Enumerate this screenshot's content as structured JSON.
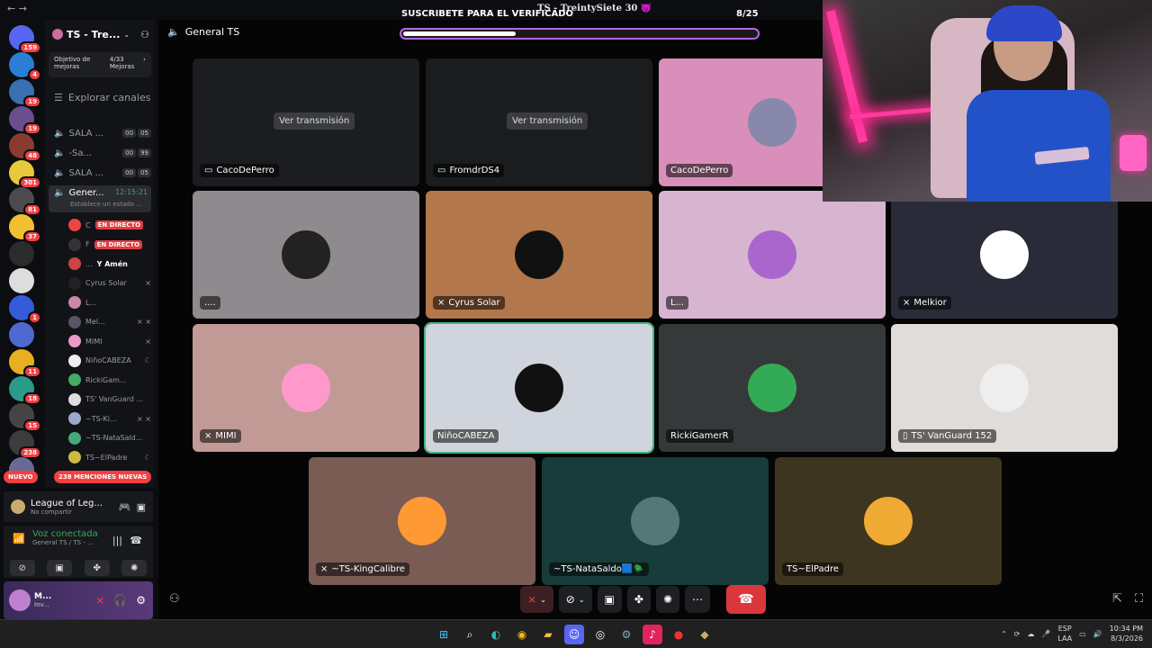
{
  "window": {
    "title": "TS - TreintySiete 30 😈"
  },
  "guilds": [
    {
      "badge": "159",
      "color": "#5865f2"
    },
    {
      "badge": "4",
      "color": "#2a7fd4"
    },
    {
      "badge": "19",
      "color": "#3a6fb0"
    },
    {
      "badge": "19",
      "color": "#6a4f8f"
    },
    {
      "badge": "48",
      "color": "#8a3b2f"
    },
    {
      "badge": "301",
      "color": "#e8c93a"
    },
    {
      "badge": "81",
      "color": "#4b4b4b"
    },
    {
      "badge": "37",
      "color": "#f0c030"
    },
    {
      "badge": "",
      "color": "#2c2c2c"
    },
    {
      "badge": "",
      "color": "#ddd"
    },
    {
      "badge": "1",
      "color": "#355bd8"
    },
    {
      "badge": "",
      "color": "#4e6ad0"
    },
    {
      "badge": "11",
      "color": "#e8b020"
    },
    {
      "badge": "18",
      "color": "#2a9a8a"
    },
    {
      "badge": "15",
      "color": "#444"
    },
    {
      "badge": "238",
      "color": "#3c3c3c"
    },
    {
      "badge": "",
      "color": "#6a6a9a"
    }
  ],
  "server": {
    "name": "TS - Tre...",
    "boost_label": "Objetivo de mejoras",
    "boost_value": "4/33",
    "boost_unit": "Mejoras",
    "explore": "Explorar canales"
  },
  "channels": [
    {
      "name": "SALA ...",
      "c1": "00",
      "c2": "05"
    },
    {
      "name": "-Sa...",
      "c1": "00",
      "c2": "99"
    },
    {
      "name": "SALA ...",
      "c1": "00",
      "c2": "05"
    }
  ],
  "active_channel": {
    "name": "Gener...",
    "time": "12:15:21",
    "status": "Establece un estado ..."
  },
  "members": [
    {
      "name": "C",
      "live": "EN DIRECTO",
      "color": "#e44"
    },
    {
      "name": "F",
      "live": "EN DIRECTO",
      "color": "#333"
    },
    {
      "name": "...",
      "tag": "Y Amén",
      "color": "#c44"
    },
    {
      "name": "Cyrus Solar",
      "icon": "⨯",
      "color": "#222"
    },
    {
      "name": "L...",
      "icon": "",
      "color": "#c8a"
    },
    {
      "name": "Mel...",
      "icon": "⨯ ⨯",
      "color": "#556"
    },
    {
      "name": "MIMI",
      "icon": "⨯",
      "color": "#e9c"
    },
    {
      "name": "NiñoCABEZA",
      "icon": "☾",
      "color": "#eee"
    },
    {
      "name": "RickiGam...",
      "icon": "",
      "color": "#4a6"
    },
    {
      "name": "TS' VanGuard ...",
      "icon": "",
      "color": "#ddd"
    },
    {
      "name": "~TS-Ki...",
      "icon": "⨯ ⨯",
      "color": "#9ac"
    },
    {
      "name": "~TS-NataSald...",
      "icon": "",
      "color": "#4a7"
    },
    {
      "name": "TS~ElPadre",
      "icon": "☾",
      "color": "#cb4"
    }
  ],
  "pills": {
    "new": "NUEVO",
    "mentions": "238 MENCIONES NUEVAS"
  },
  "activity": {
    "title": "League of Leg...",
    "sub": "No compartir"
  },
  "voice": {
    "title": "Voz conectada",
    "sub": "General TS / TS - ..."
  },
  "user": {
    "name": "M...",
    "status": "Inv..."
  },
  "stage": {
    "channel": "General TS",
    "banner": "SUSCRIBETE PARA EL VERIFICADO",
    "counter": "8/25",
    "progress": 0.32
  },
  "tiles": [
    {
      "label": "CacoDePerro",
      "bg": "#1c1d20",
      "watch": "Ver transmisión",
      "icon": "▭"
    },
    {
      "label": "FromdrDS4",
      "bg": "#1a1c1d",
      "watch": "Ver transmisión",
      "icon": "▭"
    },
    {
      "label": "CacoDePerro",
      "bg": "#d98fba",
      "watch": "",
      "icon": ""
    },
    {
      "label": "....",
      "bg": "#8f8a8e",
      "watch": "",
      "icon": ""
    },
    {
      "label": "Cyrus Solar",
      "bg": "#b2774b",
      "watch": "",
      "icon": "⨯"
    },
    {
      "label": "L...",
      "bg": "#d7b4cf",
      "watch": "",
      "icon": ""
    },
    {
      "label": "Melkior",
      "bg": "#2a2b38",
      "watch": "",
      "icon": "⨯"
    },
    {
      "label": "MIMI",
      "bg": "#c19a95",
      "watch": "",
      "icon": "⨯"
    },
    {
      "label": "NiñoCABEZA",
      "bg": "#d0d4dc",
      "watch": "",
      "icon": ""
    },
    {
      "label": "RickiGamerR",
      "bg": "#36393a",
      "watch": "",
      "icon": ""
    },
    {
      "label": "TS' VanGuard 152",
      "bg": "#e0dcd9",
      "watch": "",
      "icon": "▯"
    },
    {
      "label": "~TS-KingCalibre",
      "bg": "#7a5c55",
      "watch": "",
      "icon": "⨯"
    },
    {
      "label": "~TS-NataSaldo🟦🪲",
      "bg": "#173c3a",
      "watch": "",
      "icon": ""
    },
    {
      "label": "TS~ElPadre",
      "bg": "#3e3520",
      "watch": "",
      "icon": ""
    }
  ],
  "taskbar": {
    "lang1": "ESP",
    "lang2": "LAA",
    "time": "10:34 PM",
    "date": "8/3/2026"
  }
}
